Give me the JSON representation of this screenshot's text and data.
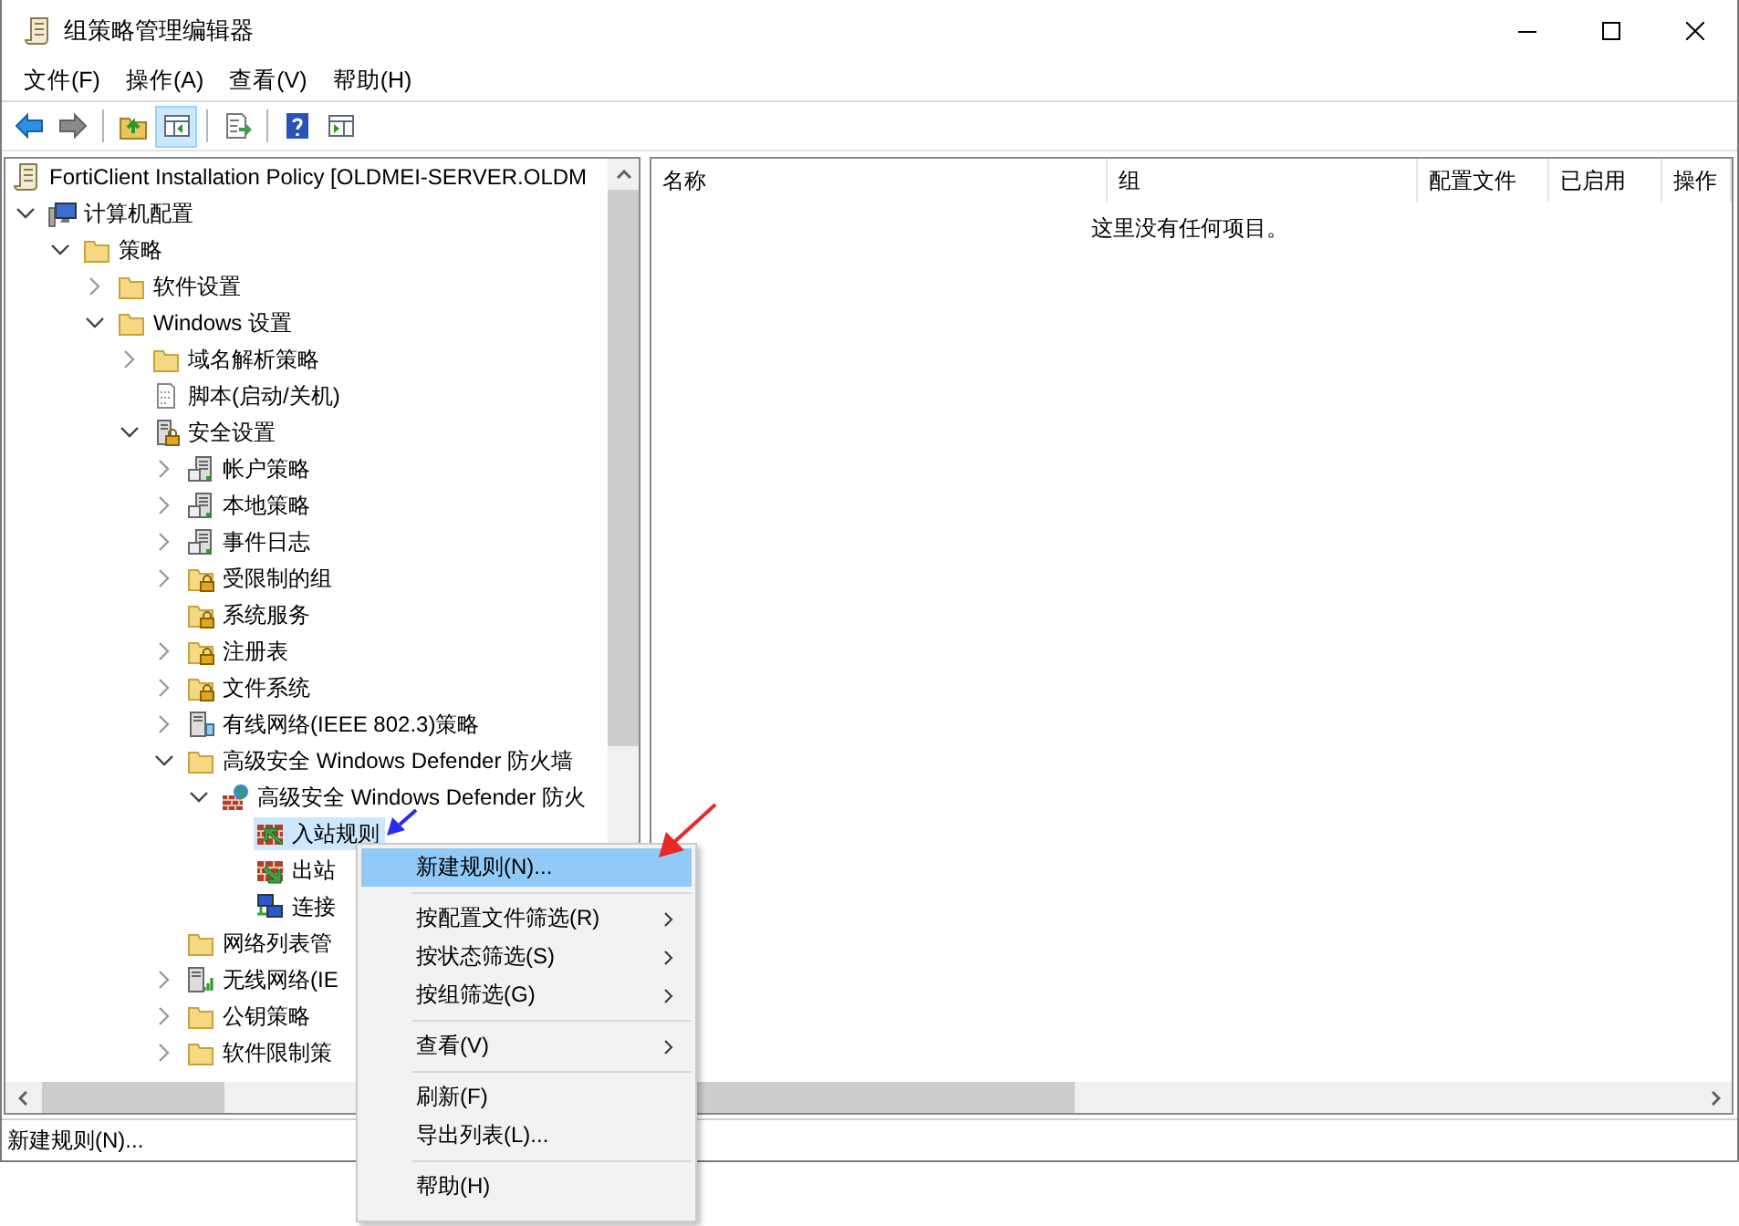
{
  "window": {
    "title": "组策略管理编辑器"
  },
  "menu_bar": [
    {
      "label": "文件(F)"
    },
    {
      "label": "操作(A)"
    },
    {
      "label": "查看(V)"
    },
    {
      "label": "帮助(H)"
    }
  ],
  "toolbar": [
    {
      "pressed": false
    },
    {
      "pressed": false
    },
    {
      "pressed": false
    },
    {
      "pressed": true
    },
    {
      "pressed": false
    },
    {
      "pressed": false
    },
    {
      "pressed": false
    }
  ],
  "tree": {
    "items": [
      {
        "label": "FortiClient Installation Policy [OLDMEI-SERVER.OLDM",
        "kind": "policy",
        "selected": false,
        "children": [
          {
            "label": "计算机配置",
            "kind": "computer",
            "expanded": true,
            "selected": false,
            "children": [
              {
                "label": "策略",
                "kind": "folder",
                "expanded": true,
                "selected": false,
                "children": [
                  {
                    "label": "软件设置",
                    "kind": "folder",
                    "expanded": false,
                    "selected": false
                  },
                  {
                    "label": "Windows 设置",
                    "kind": "folder",
                    "expanded": true,
                    "selected": false,
                    "children": [
                      {
                        "label": "域名解析策略",
                        "kind": "folder",
                        "expanded": false,
                        "selected": false
                      },
                      {
                        "label": "脚本(启动/关机)",
                        "kind": "script",
                        "selected": false
                      },
                      {
                        "label": "安全设置",
                        "kind": "security",
                        "expanded": true,
                        "selected": false,
                        "children": [
                          {
                            "label": "帐户策略",
                            "kind": "server",
                            "expanded": false,
                            "selected": false
                          },
                          {
                            "label": "本地策略",
                            "kind": "server",
                            "expanded": false,
                            "selected": false
                          },
                          {
                            "label": "事件日志",
                            "kind": "server",
                            "expanded": false,
                            "selected": false
                          },
                          {
                            "label": "受限制的组",
                            "kind": "lockfolder",
                            "expanded": false,
                            "selected": false
                          },
                          {
                            "label": "系统服务",
                            "kind": "lockfolder",
                            "selected": false
                          },
                          {
                            "label": "注册表",
                            "kind": "lockfolder",
                            "expanded": false,
                            "selected": false
                          },
                          {
                            "label": "文件系统",
                            "kind": "lockfolder",
                            "expanded": false,
                            "selected": false
                          },
                          {
                            "label": "有线网络(IEEE 802.3)策略",
                            "kind": "wired",
                            "expanded": false,
                            "selected": false
                          },
                          {
                            "label": "高级安全 Windows Defender 防火墙",
                            "kind": "folder",
                            "expanded": true,
                            "selected": false,
                            "children": [
                              {
                                "label": "高级安全 Windows Defender 防火",
                                "kind": "firewall",
                                "expanded": true,
                                "selected": false,
                                "children": [
                                  {
                                    "label": "入站规则",
                                    "kind": "inbound",
                                    "selected": true
                                  },
                                  {
                                    "label": "出站",
                                    "kind": "outbound",
                                    "selected": false
                                  },
                                  {
                                    "label": "连接",
                                    "kind": "connection",
                                    "selected": false
                                  }
                                ]
                              }
                            ]
                          },
                          {
                            "label": "网络列表管",
                            "kind": "folder",
                            "selected": false
                          },
                          {
                            "label": "无线网络(IE",
                            "kind": "wireless",
                            "expanded": false,
                            "selected": false
                          },
                          {
                            "label": "公钥策略",
                            "kind": "folder",
                            "expanded": false,
                            "selected": false
                          },
                          {
                            "label": "软件限制策",
                            "kind": "folder",
                            "expanded": false,
                            "selected": false
                          }
                        ]
                      }
                    ]
                  }
                ]
              }
            ]
          }
        ]
      }
    ]
  },
  "list": {
    "columns": [
      {
        "label": "名称"
      },
      {
        "label": "组"
      },
      {
        "label": "配置文件"
      },
      {
        "label": "已启用"
      },
      {
        "label": "操作"
      }
    ],
    "empty_message": "这里没有任何项目。"
  },
  "status_bar": "新建规则(N)...",
  "context_menu": [
    {
      "kind": "item",
      "label": "新建规则(N)...",
      "submenu": false,
      "highlighted": true
    },
    {
      "kind": "separator"
    },
    {
      "kind": "item",
      "label": "按配置文件筛选(R)",
      "submenu": true,
      "highlighted": false
    },
    {
      "kind": "item",
      "label": "按状态筛选(S)",
      "submenu": true,
      "highlighted": false
    },
    {
      "kind": "item",
      "label": "按组筛选(G)",
      "submenu": true,
      "highlighted": false
    },
    {
      "kind": "separator"
    },
    {
      "kind": "item",
      "label": "查看(V)",
      "submenu": true,
      "highlighted": false
    },
    {
      "kind": "separator"
    },
    {
      "kind": "item",
      "label": "刷新(F)",
      "submenu": false,
      "highlighted": false
    },
    {
      "kind": "item",
      "label": "导出列表(L)...",
      "submenu": false,
      "highlighted": false
    },
    {
      "kind": "separator"
    },
    {
      "kind": "item",
      "label": "帮助(H)",
      "submenu": false,
      "highlighted": false
    }
  ]
}
